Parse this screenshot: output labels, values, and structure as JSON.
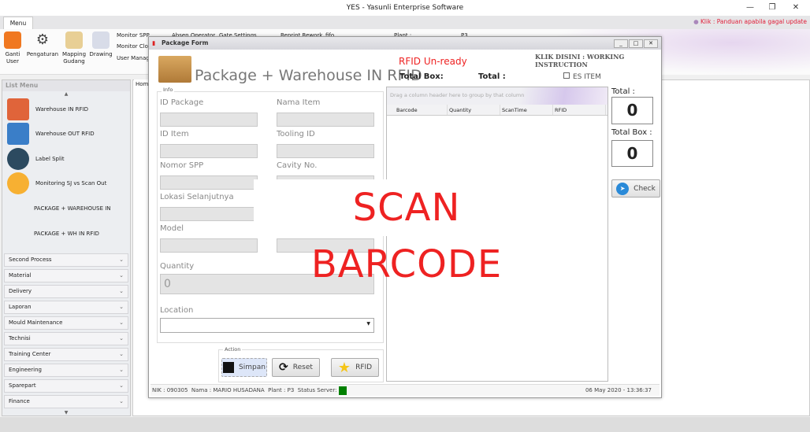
{
  "app": {
    "title": "YES - Yasunli Enterprise Software",
    "help_link": "Klik : Panduan apabila gagal update"
  },
  "ribbon": {
    "tab": "Menu",
    "buttons": [
      {
        "label": "Ganti User"
      },
      {
        "label": "Pengaturan"
      },
      {
        "label": "Mapping Gudang"
      },
      {
        "label": "Drawing"
      }
    ],
    "small": [
      "Monitor SPP",
      "Monitor Clos",
      "User Manag",
      "Absen Operator",
      "Gate Settings",
      "Reprint Rework",
      "fifo"
    ],
    "plant_label": "Plant :",
    "plant_value": "P3"
  },
  "sidebar": {
    "title": "List Menu",
    "items": [
      "Warehouse IN RFID",
      "Warehouse OUT RFID",
      "Label Split",
      "Monitoring SJ vs Scan Out",
      "PACKAGE + WAREHOUSE IN",
      "PACKAGE + WH IN RFID"
    ],
    "categories": [
      "Second Process",
      "Material",
      "Delivery",
      "Laporan",
      "Mould Maintenance",
      "Technisi",
      "Training Center",
      "Engineering",
      "Sparepart",
      "Finance"
    ]
  },
  "home_tab": "Hom",
  "form": {
    "title": "Package Form",
    "heading": "Package + Warehouse IN RFID",
    "rfid_status": "RFID Un-ready",
    "rfid_status_color": "#ee2222",
    "working_instruction": "KLIK DISINI : WORKING INSTRUCTION",
    "total_box_label": "Total Box:",
    "total_label": "Total :",
    "es_item": "ES ITEM",
    "info_group": "Info",
    "fields": {
      "id_package": "ID Package",
      "nama_item": "Nama Item",
      "id_item": "ID Item",
      "tooling_id": "Tooling ID",
      "nomor_spp": "Nomor SPP",
      "cavity_no": "Cavity No.",
      "lokasi": "Lokasi Selanjutnya",
      "model": "Model",
      "quantity": "Quantity",
      "quantity_value": "0",
      "location": "Location"
    },
    "action_group": "Action",
    "simpan": "Simpan",
    "reset": "Reset",
    "rfid": "RFID",
    "grid": {
      "group_hint": "Drag a column header here to group by that column",
      "columns": [
        "Barcode",
        "Quantity",
        "ScanTime",
        "RFID"
      ]
    },
    "right": {
      "total_label": "Total :",
      "total_value": "0",
      "total_box_label": "Total Box :",
      "total_box_value": "0",
      "check": "Check"
    },
    "status": {
      "nik_label": "NIK :",
      "nik": "090305",
      "nama_label": "Nama :",
      "nama": "MARIO HUSADANA",
      "plant_label": "Plant :",
      "plant": "P3",
      "server_label": "Status Server:",
      "server_color": "#008000",
      "datetime": "06 May 2020 - 13:36:37"
    },
    "overlay": "SCAN BARCODE"
  }
}
